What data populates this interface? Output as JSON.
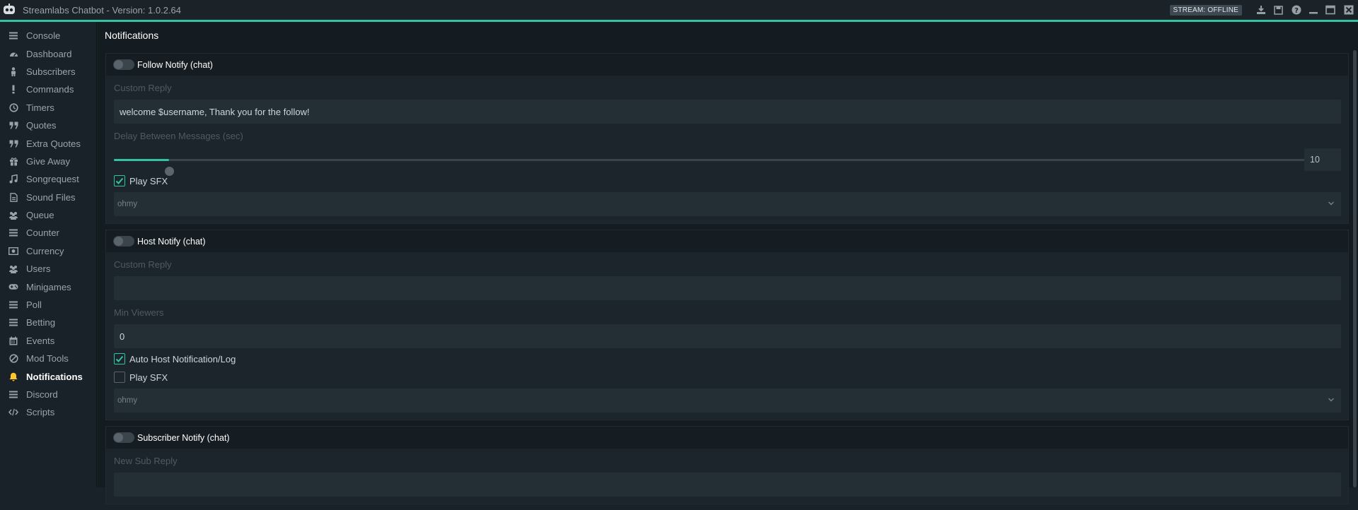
{
  "window": {
    "title": "Streamlabs Chatbot - Version: 1.0.2.64",
    "stream_status": "STREAM: OFFLINE",
    "colors": {
      "accent": "#31c3a2",
      "active_icon": "#ffc629"
    }
  },
  "sidebar": {
    "items": [
      {
        "label": "Console",
        "icon": "menu-icon"
      },
      {
        "label": "Dashboard",
        "icon": "dashboard-icon"
      },
      {
        "label": "Subscribers",
        "icon": "person-icon"
      },
      {
        "label": "Commands",
        "icon": "exclamation-icon"
      },
      {
        "label": "Timers",
        "icon": "clock-icon"
      },
      {
        "label": "Quotes",
        "icon": "quote-icon"
      },
      {
        "label": "Extra Quotes",
        "icon": "quote-icon"
      },
      {
        "label": "Give Away",
        "icon": "gift-icon"
      },
      {
        "label": "Songrequest",
        "icon": "music-note-icon"
      },
      {
        "label": "Sound Files",
        "icon": "file-icon"
      },
      {
        "label": "Queue",
        "icon": "users-icon"
      },
      {
        "label": "Counter",
        "icon": "menu-icon"
      },
      {
        "label": "Currency",
        "icon": "currency-icon"
      },
      {
        "label": "Users",
        "icon": "users-icon"
      },
      {
        "label": "Minigames",
        "icon": "gamepad-icon"
      },
      {
        "label": "Poll",
        "icon": "menu-icon"
      },
      {
        "label": "Betting",
        "icon": "menu-icon"
      },
      {
        "label": "Events",
        "icon": "calendar-icon"
      },
      {
        "label": "Mod Tools",
        "icon": "ban-icon"
      },
      {
        "label": "Notifications",
        "icon": "bell-icon"
      },
      {
        "label": "Discord",
        "icon": "menu-icon"
      },
      {
        "label": "Scripts",
        "icon": "code-icon"
      }
    ],
    "active_index": 19
  },
  "main": {
    "page_title": "Notifications",
    "follow": {
      "title": "Follow Notify (chat)",
      "enabled": false,
      "custom_reply_label": "Custom Reply",
      "custom_reply_value": "welcome $username, Thank you for the follow!",
      "delay_label": "Delay Between Messages (sec)",
      "delay_value": "10",
      "delay_fraction": 0.046,
      "play_sfx_label": "Play SFX",
      "play_sfx_checked": true,
      "sound_value": "ohmy"
    },
    "host": {
      "title": "Host Notify (chat)",
      "enabled": false,
      "custom_reply_label": "Custom Reply",
      "custom_reply_value": "",
      "min_viewers_label": "Min Viewers",
      "min_viewers_value": "0",
      "auto_host_label": "Auto Host Notification/Log",
      "auto_host_checked": true,
      "play_sfx_label": "Play SFX",
      "play_sfx_checked": false,
      "sound_value": "ohmy"
    },
    "subscriber": {
      "title": "Subscriber Notify (chat)",
      "enabled": false,
      "new_sub_reply_label": "New Sub Reply"
    }
  }
}
